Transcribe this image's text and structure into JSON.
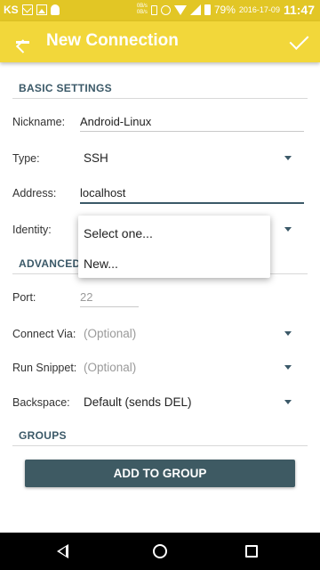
{
  "status_bar": {
    "carrier": "KS",
    "net_speed_up": "0B/s",
    "net_speed_down": "0B/s",
    "battery": "79%",
    "date": "2016-17-09",
    "time": "11:47",
    "icons": [
      "mail-icon",
      "image-icon",
      "linux-icon",
      "vibrate-icon",
      "alarm-icon",
      "wifi-icon",
      "signal-icon",
      "battery-icon"
    ]
  },
  "app_bar": {
    "title": "New Connection",
    "back_icon": "arrow-back-icon",
    "save_icon": "check-icon"
  },
  "basic_settings": {
    "header": "BASIC SETTINGS",
    "nickname_label": "Nickname:",
    "nickname_value": "Android-Linux",
    "type_label": "Type:",
    "type_value": "SSH",
    "address_label": "Address:",
    "address_value": "localhost",
    "identity_label": "Identity:"
  },
  "identity_popup": {
    "options": [
      "Select one...",
      "New..."
    ]
  },
  "advanced": {
    "header": "ADVANCED",
    "port_label": "Port:",
    "port_value": "22",
    "connect_via_label": "Connect Via:",
    "connect_via_value": "(Optional)",
    "run_snippet_label": "Run Snippet:",
    "run_snippet_value": "(Optional)",
    "backspace_label": "Backspace:",
    "backspace_value": "Default (sends DEL)"
  },
  "groups": {
    "header": "GROUPS",
    "add_button": "ADD TO GROUP"
  },
  "colors": {
    "status_bar": "#e2c625",
    "app_bar": "#f2d73a",
    "accent": "#3b5968",
    "button": "#3e5a63"
  }
}
